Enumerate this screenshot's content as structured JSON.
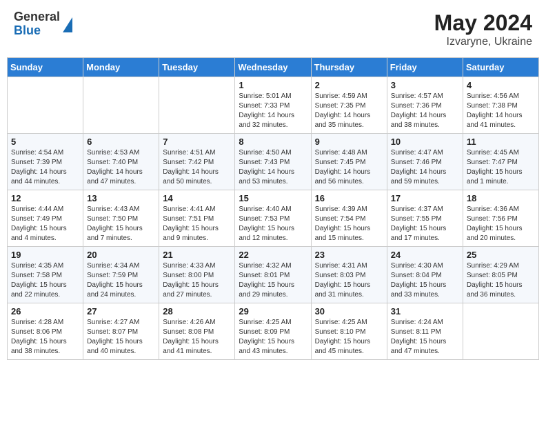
{
  "header": {
    "logo_general": "General",
    "logo_blue": "Blue",
    "month_title": "May 2024",
    "location": "Izvaryne, Ukraine"
  },
  "days_of_week": [
    "Sunday",
    "Monday",
    "Tuesday",
    "Wednesday",
    "Thursday",
    "Friday",
    "Saturday"
  ],
  "weeks": [
    [
      {
        "day": "",
        "details": ""
      },
      {
        "day": "",
        "details": ""
      },
      {
        "day": "",
        "details": ""
      },
      {
        "day": "1",
        "details": "Sunrise: 5:01 AM\nSunset: 7:33 PM\nDaylight: 14 hours and 32 minutes."
      },
      {
        "day": "2",
        "details": "Sunrise: 4:59 AM\nSunset: 7:35 PM\nDaylight: 14 hours and 35 minutes."
      },
      {
        "day": "3",
        "details": "Sunrise: 4:57 AM\nSunset: 7:36 PM\nDaylight: 14 hours and 38 minutes."
      },
      {
        "day": "4",
        "details": "Sunrise: 4:56 AM\nSunset: 7:38 PM\nDaylight: 14 hours and 41 minutes."
      }
    ],
    [
      {
        "day": "5",
        "details": "Sunrise: 4:54 AM\nSunset: 7:39 PM\nDaylight: 14 hours and 44 minutes."
      },
      {
        "day": "6",
        "details": "Sunrise: 4:53 AM\nSunset: 7:40 PM\nDaylight: 14 hours and 47 minutes."
      },
      {
        "day": "7",
        "details": "Sunrise: 4:51 AM\nSunset: 7:42 PM\nDaylight: 14 hours and 50 minutes."
      },
      {
        "day": "8",
        "details": "Sunrise: 4:50 AM\nSunset: 7:43 PM\nDaylight: 14 hours and 53 minutes."
      },
      {
        "day": "9",
        "details": "Sunrise: 4:48 AM\nSunset: 7:45 PM\nDaylight: 14 hours and 56 minutes."
      },
      {
        "day": "10",
        "details": "Sunrise: 4:47 AM\nSunset: 7:46 PM\nDaylight: 14 hours and 59 minutes."
      },
      {
        "day": "11",
        "details": "Sunrise: 4:45 AM\nSunset: 7:47 PM\nDaylight: 15 hours and 1 minute."
      }
    ],
    [
      {
        "day": "12",
        "details": "Sunrise: 4:44 AM\nSunset: 7:49 PM\nDaylight: 15 hours and 4 minutes."
      },
      {
        "day": "13",
        "details": "Sunrise: 4:43 AM\nSunset: 7:50 PM\nDaylight: 15 hours and 7 minutes."
      },
      {
        "day": "14",
        "details": "Sunrise: 4:41 AM\nSunset: 7:51 PM\nDaylight: 15 hours and 9 minutes."
      },
      {
        "day": "15",
        "details": "Sunrise: 4:40 AM\nSunset: 7:53 PM\nDaylight: 15 hours and 12 minutes."
      },
      {
        "day": "16",
        "details": "Sunrise: 4:39 AM\nSunset: 7:54 PM\nDaylight: 15 hours and 15 minutes."
      },
      {
        "day": "17",
        "details": "Sunrise: 4:37 AM\nSunset: 7:55 PM\nDaylight: 15 hours and 17 minutes."
      },
      {
        "day": "18",
        "details": "Sunrise: 4:36 AM\nSunset: 7:56 PM\nDaylight: 15 hours and 20 minutes."
      }
    ],
    [
      {
        "day": "19",
        "details": "Sunrise: 4:35 AM\nSunset: 7:58 PM\nDaylight: 15 hours and 22 minutes."
      },
      {
        "day": "20",
        "details": "Sunrise: 4:34 AM\nSunset: 7:59 PM\nDaylight: 15 hours and 24 minutes."
      },
      {
        "day": "21",
        "details": "Sunrise: 4:33 AM\nSunset: 8:00 PM\nDaylight: 15 hours and 27 minutes."
      },
      {
        "day": "22",
        "details": "Sunrise: 4:32 AM\nSunset: 8:01 PM\nDaylight: 15 hours and 29 minutes."
      },
      {
        "day": "23",
        "details": "Sunrise: 4:31 AM\nSunset: 8:03 PM\nDaylight: 15 hours and 31 minutes."
      },
      {
        "day": "24",
        "details": "Sunrise: 4:30 AM\nSunset: 8:04 PM\nDaylight: 15 hours and 33 minutes."
      },
      {
        "day": "25",
        "details": "Sunrise: 4:29 AM\nSunset: 8:05 PM\nDaylight: 15 hours and 36 minutes."
      }
    ],
    [
      {
        "day": "26",
        "details": "Sunrise: 4:28 AM\nSunset: 8:06 PM\nDaylight: 15 hours and 38 minutes."
      },
      {
        "day": "27",
        "details": "Sunrise: 4:27 AM\nSunset: 8:07 PM\nDaylight: 15 hours and 40 minutes."
      },
      {
        "day": "28",
        "details": "Sunrise: 4:26 AM\nSunset: 8:08 PM\nDaylight: 15 hours and 41 minutes."
      },
      {
        "day": "29",
        "details": "Sunrise: 4:25 AM\nSunset: 8:09 PM\nDaylight: 15 hours and 43 minutes."
      },
      {
        "day": "30",
        "details": "Sunrise: 4:25 AM\nSunset: 8:10 PM\nDaylight: 15 hours and 45 minutes."
      },
      {
        "day": "31",
        "details": "Sunrise: 4:24 AM\nSunset: 8:11 PM\nDaylight: 15 hours and 47 minutes."
      },
      {
        "day": "",
        "details": ""
      }
    ]
  ]
}
